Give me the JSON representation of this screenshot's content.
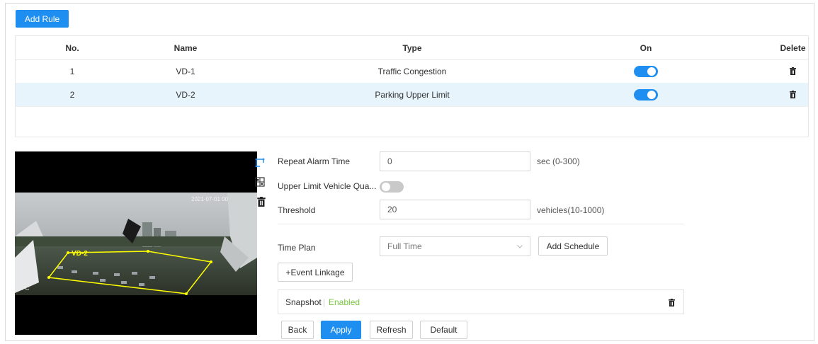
{
  "toolbar": {
    "add_rule_label": "Add Rule"
  },
  "table": {
    "headers": {
      "no": "No.",
      "name": "Name",
      "type": "Type",
      "on": "On",
      "delete": "Delete"
    },
    "rows": [
      {
        "no": "1",
        "name": "VD-1",
        "type": "Traffic Congestion",
        "on": true
      },
      {
        "no": "2",
        "name": "VD-2",
        "type": "Parking Upper Limit",
        "on": true
      }
    ]
  },
  "video": {
    "region_label": "VD-2",
    "timestamp": "2021-07-01 00",
    "channel_label": "IPC"
  },
  "form": {
    "repeat_alarm_time": {
      "label": "Repeat Alarm Time",
      "value": "0",
      "unit": "sec (0-300)"
    },
    "upper_limit": {
      "label": "Upper Limit Vehicle Qua...",
      "enabled": false
    },
    "threshold": {
      "label": "Threshold",
      "value": "20",
      "unit": "vehicles(10-1000)"
    },
    "time_plan": {
      "label": "Time Plan",
      "value": "Full Time",
      "add_schedule": "Add Schedule"
    },
    "event_linkage_label": "+Event Linkage",
    "snapshot": {
      "label": "Snapshot",
      "separator": "|",
      "status": "Enabled"
    }
  },
  "actions": {
    "back": "Back",
    "apply": "Apply",
    "refresh": "Refresh",
    "default": "Default"
  },
  "colors": {
    "accent": "#1f8ef1",
    "selected_row": "#e8f4fc",
    "enabled_text": "#7ac943",
    "rule_outline": "#ffff00"
  }
}
